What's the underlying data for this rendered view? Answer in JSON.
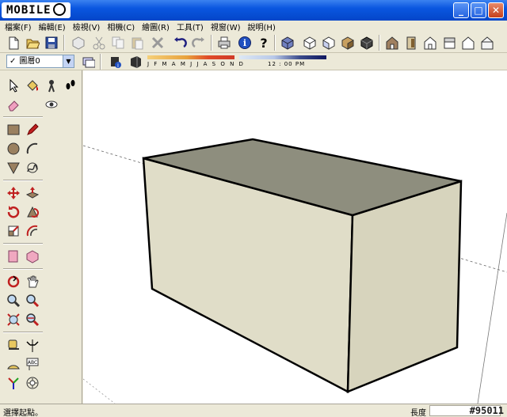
{
  "app": {
    "logo_text": "MOBILE"
  },
  "window_buttons": {
    "minimize": "_",
    "maximize": "□",
    "close": "✕"
  },
  "menu": {
    "items": [
      {
        "label": "檔案(F)"
      },
      {
        "label": "編輯(E)"
      },
      {
        "label": "檢視(V)"
      },
      {
        "label": "相機(C)"
      },
      {
        "label": "繪圖(R)"
      },
      {
        "label": "工具(T)"
      },
      {
        "label": "視窗(W)"
      },
      {
        "label": "說明(H)"
      }
    ]
  },
  "layer": {
    "selected": "圖層0",
    "checkmark": "✓",
    "dropdown_arrow": "▼"
  },
  "shadow_settings": {
    "month_letters": "J F M A M J J A S O N D",
    "time_display": "12 : 00 PM"
  },
  "status": {
    "text": "選擇起點。",
    "measurement_label": "長度",
    "measurement_value": "",
    "watermark": "#95011"
  },
  "colors": {
    "title_bar": "#0a56e0",
    "face_front": "#e0ddc8",
    "face_side": "#d4d1ba",
    "face_top": "#8e8e7e",
    "edge": "#000000",
    "axis_red": "#d04040",
    "axis_green": "#40a040",
    "axis_blue": "#4040d0",
    "guide": "#000000"
  },
  "icons": {
    "toolbar1": [
      "new-file-icon",
      "open-folder-icon",
      "save-icon",
      "make-component-icon",
      "cut-icon",
      "copy-icon",
      "paste-icon",
      "erase-icon",
      "undo-icon",
      "redo-icon",
      "print-icon",
      "model-info-icon",
      "help-icon",
      "iso-view-icon",
      "top-view-icon",
      "front-view-icon",
      "right-view-icon",
      "back-view-icon",
      "xray-icon",
      "wireframe-icon",
      "hidden-line-icon",
      "shaded-icon",
      "shaded-texture-icon"
    ],
    "toolbar2": [
      "layer-manager-icon",
      "shadow-settings-icon",
      "shadow-toggle-icon"
    ],
    "palette": [
      "select-icon",
      "paint-bucket-icon",
      "walk-icon",
      "footprints-icon",
      "eraser-icon",
      "look-around-icon",
      "rectangle-icon",
      "pencil-icon",
      "circle-icon",
      "arc-icon",
      "polygon-icon",
      "freehand-icon",
      "move-icon",
      "push-pull-icon",
      "rotate-icon",
      "follow-me-icon",
      "scale-icon",
      "offset-icon",
      "section-plane-icon",
      "section-display-icon",
      "orbit-icon",
      "pan-icon",
      "zoom-icon",
      "zoom-window-icon",
      "zoom-extents-icon",
      "previous-view-icon",
      "tape-measure-icon",
      "dimension-icon",
      "protractor-icon",
      "text-icon",
      "axes-icon",
      "3d-text-icon"
    ]
  }
}
